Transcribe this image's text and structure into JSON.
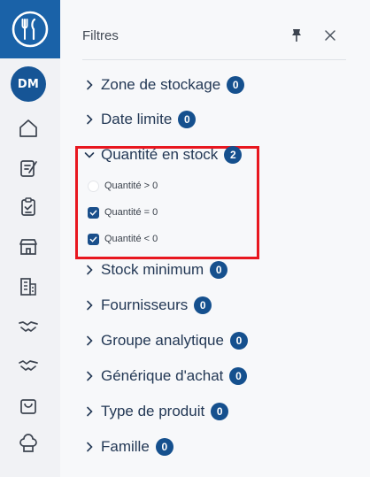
{
  "rail": {
    "logo_icon": "fork-knife-logo-icon",
    "avatar": "DM",
    "items": [
      {
        "name": "home-icon"
      },
      {
        "name": "edit-document-icon"
      },
      {
        "name": "clipboard-check-icon"
      },
      {
        "name": "store-icon"
      },
      {
        "name": "building-icon"
      },
      {
        "name": "handshake-icon"
      },
      {
        "name": "handshake-alt-icon"
      },
      {
        "name": "shopping-bag-icon"
      },
      {
        "name": "chef-hat-icon"
      }
    ]
  },
  "panel": {
    "title": "Filtres",
    "pin_icon": "pin-icon",
    "close_icon": "close-icon",
    "filters": [
      {
        "label": "Zone de stockage",
        "count": "0",
        "expanded": false
      },
      {
        "label": "Date limite",
        "count": "0",
        "expanded": false
      },
      {
        "label": "Quantité en stock",
        "count": "2",
        "expanded": true,
        "options": [
          {
            "label": "Quantité > 0",
            "checked": false
          },
          {
            "label": "Quantité = 0",
            "checked": true
          },
          {
            "label": "Quantité < 0",
            "checked": true
          }
        ]
      },
      {
        "label": "Stock minimum",
        "count": "0",
        "expanded": false
      },
      {
        "label": "Fournisseurs",
        "count": "0",
        "expanded": false
      },
      {
        "label": "Groupe analytique",
        "count": "0",
        "expanded": false
      },
      {
        "label": "Générique d'achat",
        "count": "0",
        "expanded": false
      },
      {
        "label": "Type de produit",
        "count": "0",
        "expanded": false
      },
      {
        "label": "Famille",
        "count": "0",
        "expanded": false
      }
    ]
  },
  "colors": {
    "brand": "#1a62a8",
    "badge": "#15508e",
    "highlight": "#e8171f",
    "text": "#233855"
  }
}
